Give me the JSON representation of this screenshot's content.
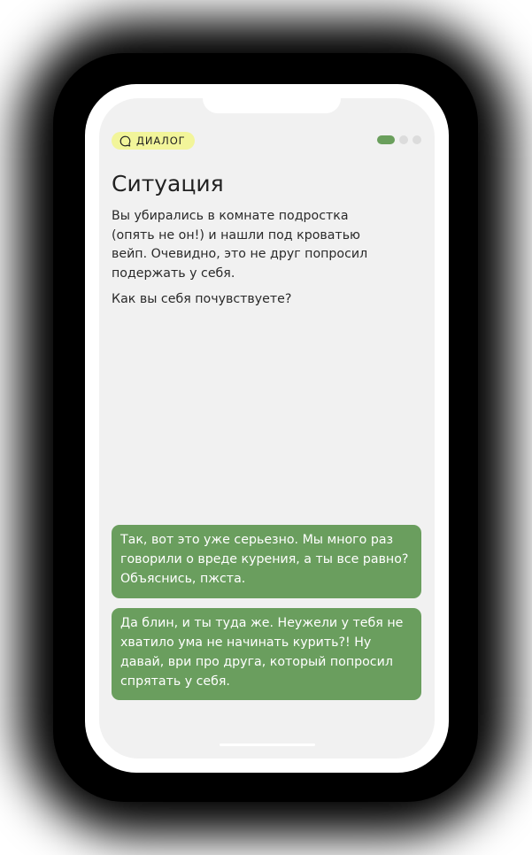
{
  "header": {
    "badge_label": "ДИАЛОГ",
    "badge_icon": "speech-bubble-icon",
    "badge_color": "#f2f59a",
    "progress": {
      "current": 1,
      "total": 3
    }
  },
  "content": {
    "title": "Ситуация",
    "paragraphs": [
      "Вы убирались в комнате подростка (опять не он!) и нашли под кроватью вейп. Очевидно, это не друг попросил подержать у себя.",
      "Как вы себя почувствуете?"
    ]
  },
  "options": [
    "Так, вот это уже серьезно. Мы много раз говорили о вреде курения, а ты все равно? Объяснись, пжста.",
    "Да блин, и ты туда же. Неужели у тебя не хватило ума не начинать курить?! Ну давай, ври про друга, который попросил спрятать у себя."
  ],
  "colors": {
    "accent": "#6a9e5e",
    "screen_bg": "#f1f1f1"
  }
}
